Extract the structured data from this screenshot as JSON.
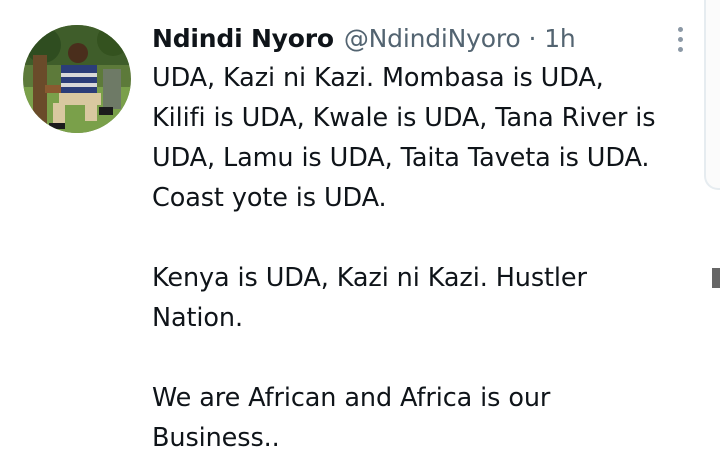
{
  "tweet": {
    "author": {
      "name": "Ndindi Nyoro",
      "handle": "@NdindiNyoro",
      "avatar_icon": "profile-photo"
    },
    "separator": "·",
    "time": "1h",
    "more_icon": "vertical-ellipsis-icon",
    "paragraphs": [
      {
        "lines": [
          "UDA, Kazi ni Kazi. Mombasa is UDA,",
          "Kilifi is UDA, Kwale is UDA, Tana River is",
          "UDA, Lamu is UDA, Taita Taveta is UDA.",
          "Coast yote is UDA."
        ]
      },
      {
        "lines": [
          "Kenya is UDA, Kazi ni Kazi. Hustler",
          "Nation."
        ]
      },
      {
        "lines": [
          "We are African and Africa is our",
          "Business.."
        ]
      }
    ]
  },
  "colors": {
    "text_primary": "#0f1419",
    "text_secondary": "#536471",
    "icon_gray": "#8b98a5",
    "background": "#ffffff"
  }
}
